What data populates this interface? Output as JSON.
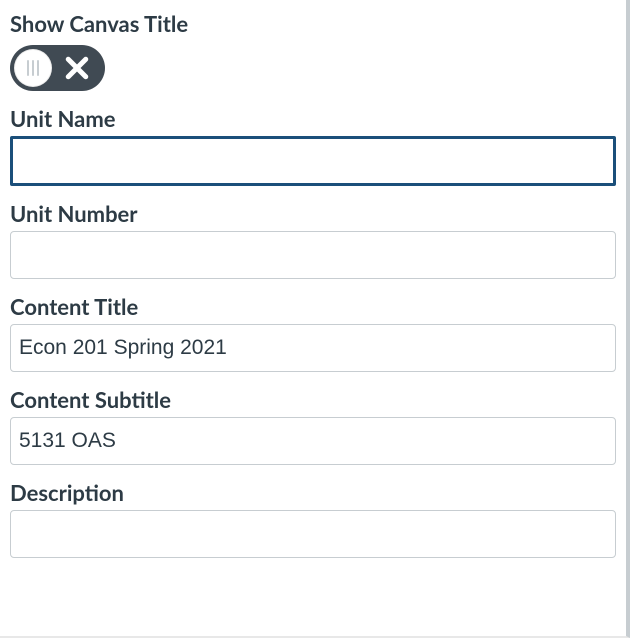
{
  "form": {
    "show_canvas_title": {
      "label": "Show Canvas Title",
      "value": false
    },
    "unit_name": {
      "label": "Unit Name",
      "value": ""
    },
    "unit_number": {
      "label": "Unit Number",
      "value": ""
    },
    "content_title": {
      "label": "Content Title",
      "value": "Econ 201 Spring 2021"
    },
    "content_subtitle": {
      "label": "Content Subtitle",
      "value": "5131 OAS"
    },
    "description": {
      "label": "Description",
      "value": ""
    }
  }
}
